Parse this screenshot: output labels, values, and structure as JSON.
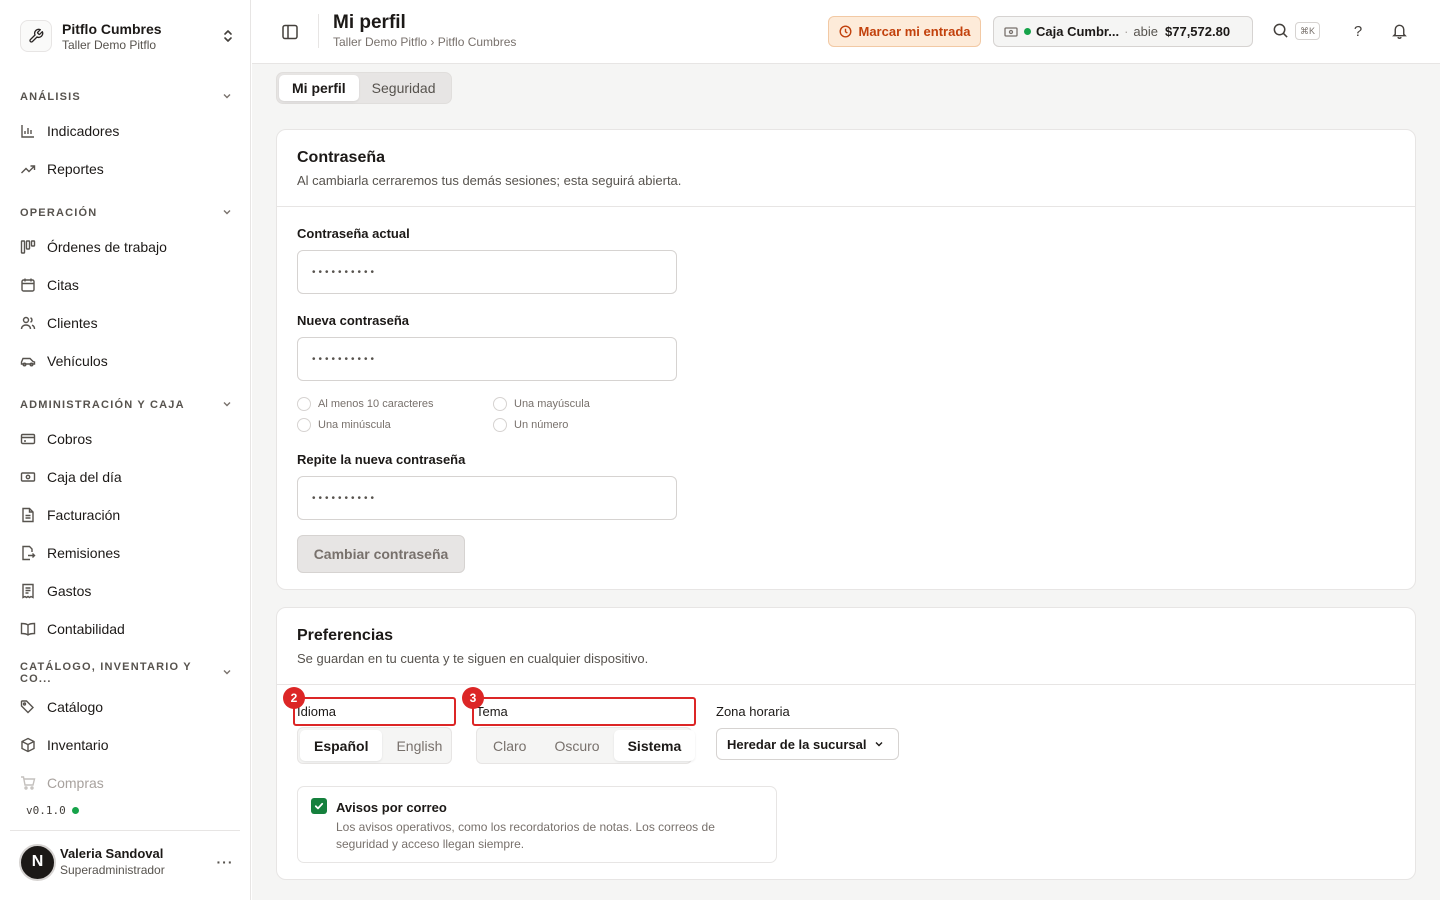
{
  "org": {
    "name": "Pitflo Cumbres",
    "subtitle": "Taller Demo Pitflo"
  },
  "sidebar": {
    "sections": [
      {
        "label": "ANÁLISIS",
        "items": [
          "Indicadores",
          "Reportes"
        ]
      },
      {
        "label": "OPERACIÓN",
        "items": [
          "Órdenes de trabajo",
          "Citas",
          "Clientes",
          "Vehículos"
        ]
      },
      {
        "label": "ADMINISTRACIÓN Y CAJA",
        "items": [
          "Cobros",
          "Caja del día",
          "Facturación",
          "Remisiones",
          "Gastos",
          "Contabilidad"
        ]
      },
      {
        "label": "CATÁLOGO, INVENTARIO Y CO...",
        "items": [
          "Catálogo",
          "Inventario",
          "Compras"
        ]
      }
    ],
    "version": "v0.1.0"
  },
  "user": {
    "initial": "N",
    "name": "Valeria Sandoval",
    "role": "Superadministrador",
    "more": "···"
  },
  "header": {
    "title": "Mi perfil",
    "breadcrumb": "Taller Demo Pitflo › Pitflo Cumbres",
    "clock_in_label": "Marcar mi entrada",
    "cash": {
      "name": "Caja Cumbr...",
      "separator": "·",
      "state": "abie",
      "amount": "$77,572.80"
    },
    "shortcut": "⌘K",
    "help": "?"
  },
  "tabs": [
    "Mi perfil",
    "Seguridad"
  ],
  "password_card": {
    "title": "Contraseña",
    "description": "Al cambiarla cerraremos tus demás sesiones; esta seguirá abierta.",
    "current_label": "Contraseña actual",
    "current_value": "••••••••••",
    "new_label": "Nueva contraseña",
    "new_value": "••••••••••",
    "requirements": [
      "Al menos 10 caracteres",
      "Una mayúscula",
      "Una minúscula",
      "Un número"
    ],
    "repeat_label": "Repite la nueva contraseña",
    "repeat_value": "••••••••••",
    "submit_label": "Cambiar contraseña"
  },
  "preferences_card": {
    "title": "Preferencias",
    "description": "Se guardan en tu cuenta y te siguen en cualquier dispositivo.",
    "language_label": "Idioma",
    "language_options": [
      "Español",
      "English"
    ],
    "language_selected": "Español",
    "theme_label": "Tema",
    "theme_options": [
      "Claro",
      "Oscuro",
      "Sistema"
    ],
    "theme_selected": "Sistema",
    "timezone_label": "Zona horaria",
    "timezone_value": "Heredar de la sucursal",
    "email_notices_title": "Avisos por correo",
    "email_notices_description": "Los avisos operativos, como los recordatorios de notas. Los correos de seguridad y acceso llegan siempre.",
    "email_notices_checked": true
  },
  "annotations": [
    "2",
    "3"
  ],
  "colors": {
    "accent_orange": "#c2410c",
    "status_green": "#16a34a",
    "annotation_red": "#dc2626",
    "checkbox_green": "#15803d"
  }
}
